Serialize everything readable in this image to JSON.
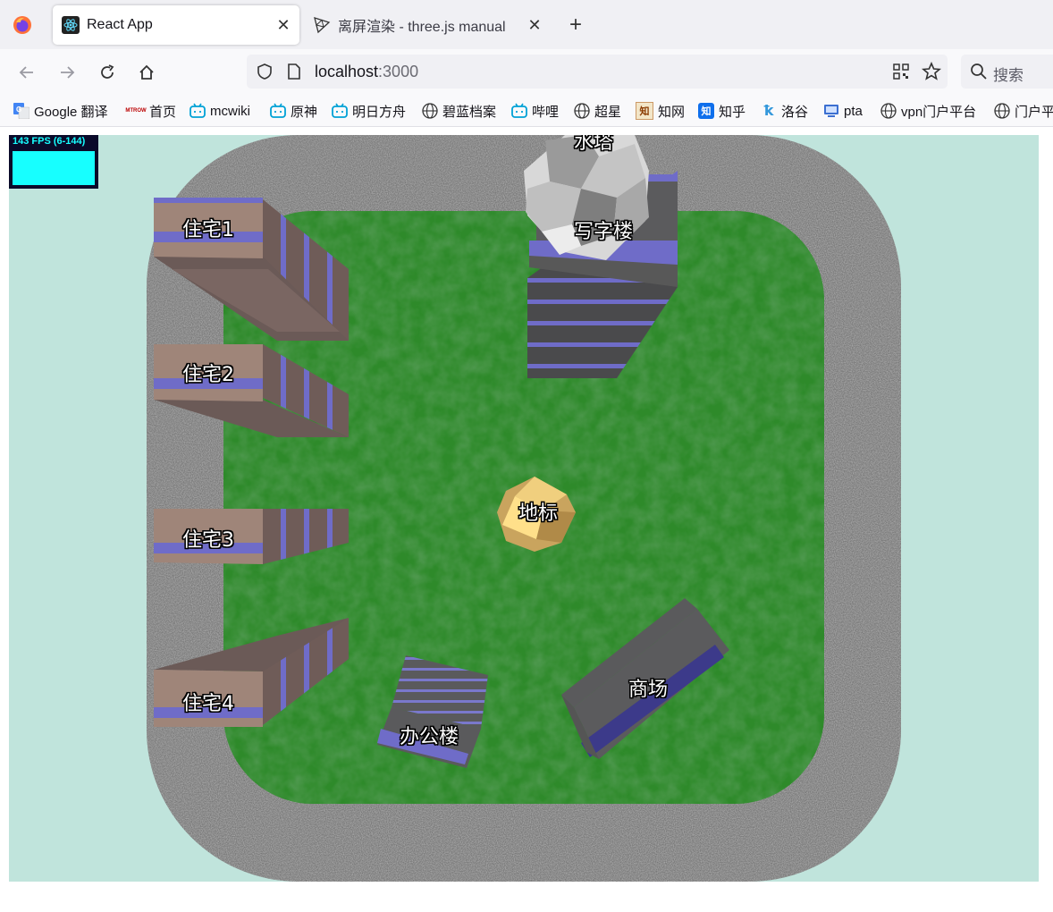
{
  "tabs": [
    {
      "title": "React App",
      "active": true
    },
    {
      "title": "离屏渲染 - three.js manual",
      "active": false
    }
  ],
  "address": {
    "host": "localhost",
    "port": ":3000"
  },
  "search": {
    "placeholder": "搜索"
  },
  "bookmarks": [
    {
      "label": "Google 翻译",
      "icon": "google-translate-icon"
    },
    {
      "label": "首页",
      "icon": "mtrcw-icon"
    },
    {
      "label": "mcwiki",
      "icon": "bilibili-icon"
    },
    {
      "label": "原神",
      "icon": "bilibili-icon"
    },
    {
      "label": "明日方舟",
      "icon": "bilibili-icon"
    },
    {
      "label": "碧蓝档案",
      "icon": "globe-icon"
    },
    {
      "label": "哔哩",
      "icon": "bilibili-icon"
    },
    {
      "label": "超星",
      "icon": "globe-icon"
    },
    {
      "label": "知网",
      "icon": "cnki-icon"
    },
    {
      "label": "知乎",
      "icon": "zhihu-icon"
    },
    {
      "label": "洛谷",
      "icon": "luogu-icon"
    },
    {
      "label": "pta",
      "icon": "pta-icon"
    },
    {
      "label": "vpn门户平台",
      "icon": "globe-icon"
    },
    {
      "label": "门户平",
      "icon": "globe-icon"
    }
  ],
  "stats": {
    "fps": "143 FPS (6-144)"
  },
  "scene": {
    "labels": {
      "water_tower": "水塔",
      "office_tower": "写字楼",
      "house1": "住宅1",
      "house2": "住宅2",
      "house3": "住宅3",
      "house4": "住宅4",
      "landmark": "地标",
      "office": "办公楼",
      "mall": "商场"
    }
  }
}
